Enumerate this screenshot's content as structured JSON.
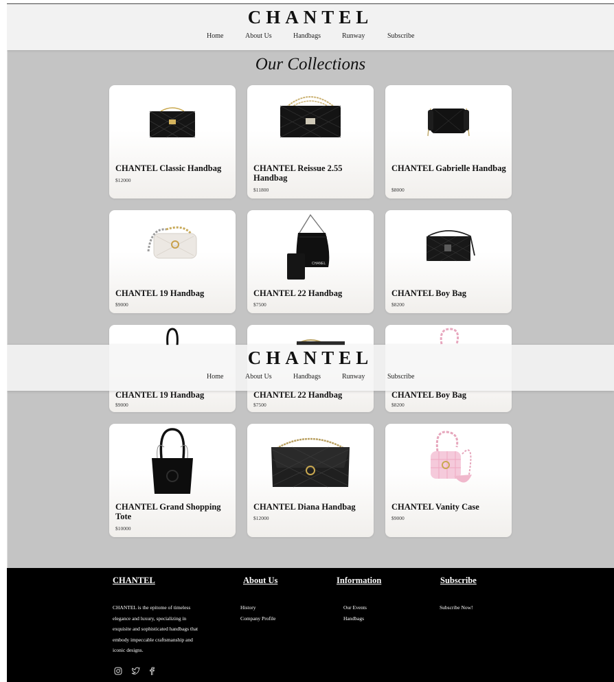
{
  "header": {
    "brand": "CHANTEL",
    "nav": [
      "Home",
      "About Us",
      "Handbags",
      "Runway",
      "Subscribe"
    ]
  },
  "page_title": "Our Collections",
  "products": [
    {
      "name": "CHANTEL Classic Handbag",
      "price": "$12000",
      "icon": "classic-flap-bag-icon"
    },
    {
      "name": "CHANTEL Reissue 2.55 Handbag",
      "price": "$11800",
      "icon": "reissue-bag-icon"
    },
    {
      "name": "CHANTEL Gabrielle Handbag",
      "price": "$8000",
      "icon": "gabrielle-bag-icon"
    },
    {
      "name": "CHANTEL 19 Handbag",
      "price": "$9000",
      "icon": "white-19-bag-icon"
    },
    {
      "name": "CHANTEL 22 Handbag",
      "price": "$7500",
      "icon": "22-bag-icon"
    },
    {
      "name": "CHANTEL Boy Bag",
      "price": "$8200",
      "icon": "boy-bag-icon"
    },
    {
      "name": "CHANTEL Grand Shopping Tote",
      "price": "$10000",
      "icon": "shopping-tote-icon"
    },
    {
      "name": "CHANTEL Diana Handbag",
      "price": "$12000",
      "icon": "diana-bag-icon"
    },
    {
      "name": "CHANTEL Vanity Case",
      "price": "$9000",
      "icon": "pink-vanity-case-icon"
    }
  ],
  "footer": {
    "col1": {
      "heading": "CHANTEL",
      "text": [
        "CHANTEL is the epitome of timeless",
        "elegance and luxury, specializing in",
        "exquisite and sophisticated handbags that",
        "embody impeccable craftsmanship and",
        "iconic designs."
      ]
    },
    "col2": {
      "heading": "About Us",
      "links": [
        "History",
        "Company Profile"
      ]
    },
    "col3": {
      "heading": "Information",
      "links": [
        "Our Events",
        "Handbags"
      ]
    },
    "col4": {
      "heading": "Subscribe",
      "links": [
        "Subscribe Now!"
      ]
    },
    "social": [
      "instagram-icon",
      "twitter-icon",
      "facebook-icon"
    ]
  }
}
